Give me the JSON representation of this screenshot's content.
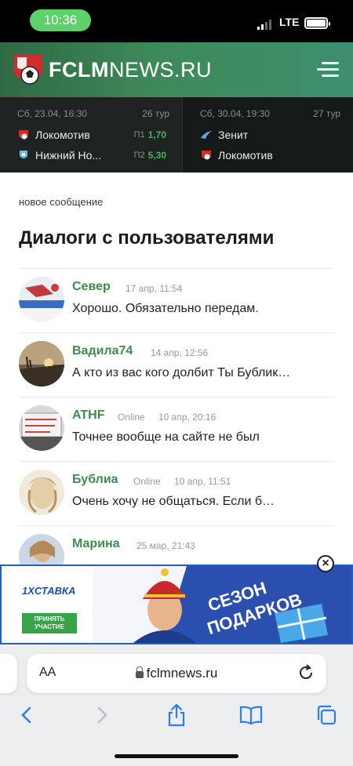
{
  "status_bar": {
    "time": "10:36",
    "network": "LTE"
  },
  "header": {
    "logo_main": "FCLM",
    "logo_rest": "NEWS.RU"
  },
  "matches": [
    {
      "date": "Сб, 23.04, 16:30",
      "round": "26 тур",
      "team1": "Локомотив",
      "team2": "Нижний Но...",
      "odd1_label": "П1",
      "odd1_value": "1,70",
      "odd2_label": "П2",
      "odd2_value": "5,30"
    },
    {
      "date": "Сб, 30.04, 19:30",
      "round": "27 тур",
      "team1": "Зенит",
      "team2": "Локомотив"
    }
  ],
  "content": {
    "new_message": "новое сообщение",
    "title": "Диалоги с пользователями",
    "dialogs": [
      {
        "name": "Север",
        "status": "",
        "date": "17 апр, 11:54",
        "text": "Хорошо. Обязательно передам."
      },
      {
        "name": "Вадила74",
        "status": "",
        "date": "14 апр, 12:56",
        "text": "А кто из вас кого долбит Ты Бублик…"
      },
      {
        "name": "ATHF",
        "status": "Online",
        "date": "10 апр, 20:16",
        "text": "Точнее вообще на сайте не был"
      },
      {
        "name": "Бублиа",
        "status": "Online",
        "date": "10 апр, 11:51",
        "text": "Очень хочу не общаться. Если б…"
      },
      {
        "name": "Марина",
        "status": "",
        "date": "25 мар, 21:43",
        "text": ""
      }
    ]
  },
  "ad": {
    "brand": "1XСТАВКА",
    "cta": "ПРИНЯТЬ УЧАСТИЕ",
    "headline_1": "СЕЗОН",
    "headline_2": "ПОДАРКОВ"
  },
  "browser": {
    "aa_label": "AA",
    "url": "fclmnews.ru"
  },
  "colors": {
    "accent_green": "#3e8a4f",
    "header_green": "#3e8a5a",
    "ad_blue": "#2a4fae"
  }
}
